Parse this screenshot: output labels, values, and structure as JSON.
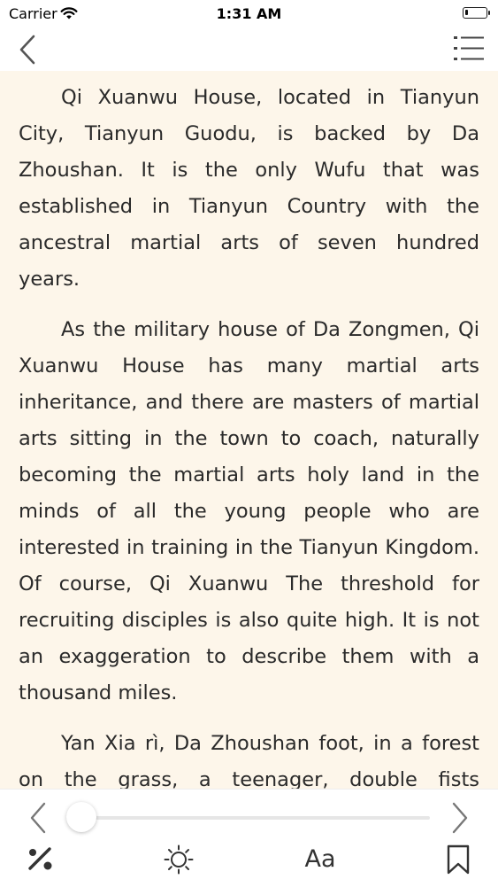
{
  "status_bar": {
    "carrier": "Carrier",
    "time": "1:31 AM",
    "battery_level": 0.15
  },
  "nav": {
    "back_icon": "chevron-left-icon",
    "menu_icon": "list-icon"
  },
  "content": {
    "paragraphs": [
      "Qi Xuanwu House, located in Tianyun City, Tianyun Guodu, is backed by Da Zhoushan. It is the only Wufu that was established in Tianyun Country with the ancestral martial arts of seven hundred years.",
      "As the military house of Da Zongmen, Qi Xuanwu House has many martial arts inheritance, and there are masters of martial arts sitting in the town to coach, naturally becoming the martial arts holy land in the minds of all the young people who are interested in training in the Tianyun Kingdom. Of course, Qi Xuanwu The threshold for recruiting disciples is also quite high. It is not an exaggeration to describe them with a thousand miles.",
      "Yan Xia rì, Da Zhoushan foot, in a forest on the grass, a teenager, double fists wrapped around the cloth, standing on top of"
    ]
  },
  "toolbar": {
    "prev_icon": "chevron-left-icon",
    "next_icon": "chevron-right-icon",
    "progress": 0.0,
    "night_mode_icon": "night-mode-icon",
    "brightness_icon": "sun-icon",
    "font_label": "Aa",
    "bookmark_icon": "bookmark-icon"
  }
}
